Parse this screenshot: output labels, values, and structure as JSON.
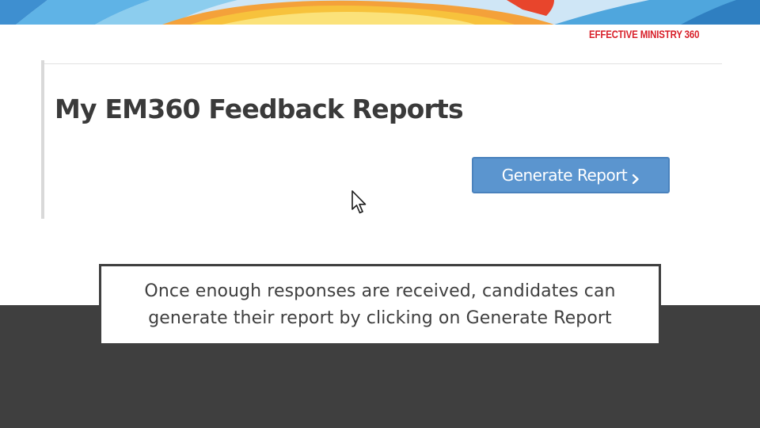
{
  "brand": {
    "logo_text": "EFFECTIVE MINISTRY 360"
  },
  "colors": {
    "brand_red": "#d8202a",
    "button_blue": "#5b95cf",
    "dark_band": "#3f3f3f",
    "banner_orange": "#f4a13a",
    "banner_blue": "#4fa6dd"
  },
  "screenshot": {
    "page_title": "My EM360 Feedback Reports",
    "generate_button_label": "Generate Report",
    "button_icon": "chevron-right-icon",
    "cursor_icon": "mouse-pointer-icon"
  },
  "caption": {
    "line1": "Once enough responses are received, candidates can",
    "line2": "generate their report by clicking on Generate Report"
  }
}
